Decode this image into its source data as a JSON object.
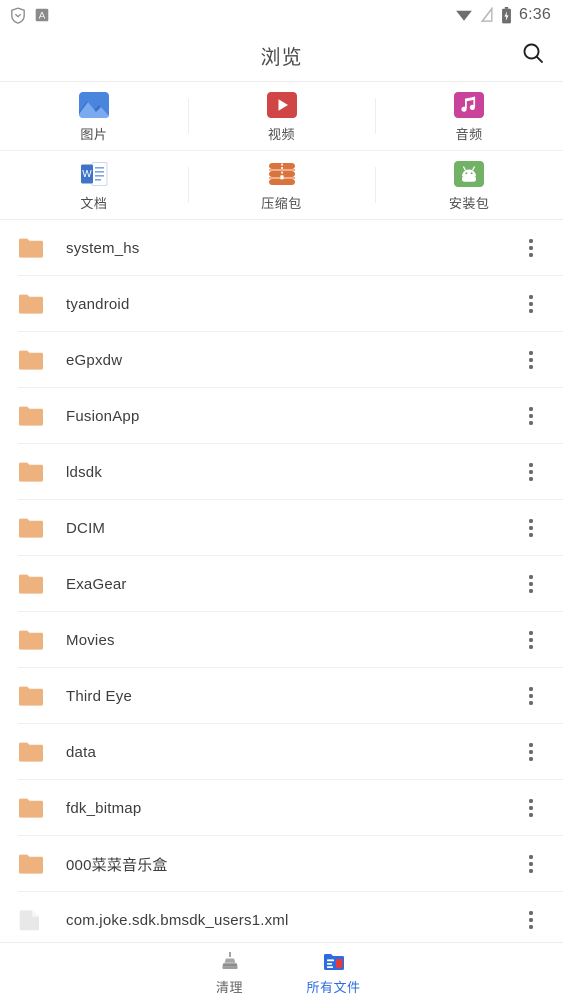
{
  "statusbar": {
    "left_icons": [
      "shield-icon",
      "a-badge-icon"
    ],
    "right_icons": [
      "wifi-icon",
      "signal-off-icon",
      "battery-charging-icon"
    ],
    "time": "6:36"
  },
  "appbar": {
    "title": "浏览",
    "search_icon": "search-icon"
  },
  "categories": [
    {
      "label": "图片",
      "icon": "image-icon",
      "color": "#4a85dd"
    },
    {
      "label": "视频",
      "icon": "video-icon",
      "color": "#d04545"
    },
    {
      "label": "音频",
      "icon": "audio-icon",
      "color": "#c9439a"
    },
    {
      "label": "文档",
      "icon": "document-icon",
      "color": "#3f74c8"
    },
    {
      "label": "压缩包",
      "icon": "archive-icon",
      "color": "#d9743f"
    },
    {
      "label": "安装包",
      "icon": "apk-icon",
      "color": "#72b266"
    }
  ],
  "files": [
    {
      "name": "system_hs",
      "type": "folder"
    },
    {
      "name": "tyandroid",
      "type": "folder"
    },
    {
      "name": "eGpxdw",
      "type": "folder"
    },
    {
      "name": "FusionApp",
      "type": "folder"
    },
    {
      "name": "ldsdk",
      "type": "folder"
    },
    {
      "name": "DCIM",
      "type": "folder"
    },
    {
      "name": "ExaGear",
      "type": "folder"
    },
    {
      "name": "Movies",
      "type": "folder"
    },
    {
      "name": "Third Eye",
      "type": "folder"
    },
    {
      "name": "data",
      "type": "folder"
    },
    {
      "name": "fdk_bitmap",
      "type": "folder"
    },
    {
      "name": "000菜菜音乐盒",
      "type": "folder"
    },
    {
      "name": "com.joke.sdk.bmsdk_users1.xml",
      "type": "file"
    }
  ],
  "bottomnav": {
    "items": [
      {
        "label": "清理",
        "icon": "clean-icon",
        "active": false
      },
      {
        "label": "所有文件",
        "icon": "all-files-icon",
        "active": true
      }
    ],
    "accent_color": "#2d6cdf"
  },
  "colors": {
    "folder": "#edb27e",
    "file": "#e8e8e8",
    "divider": "#efefef",
    "text": "#3d3d3d"
  }
}
